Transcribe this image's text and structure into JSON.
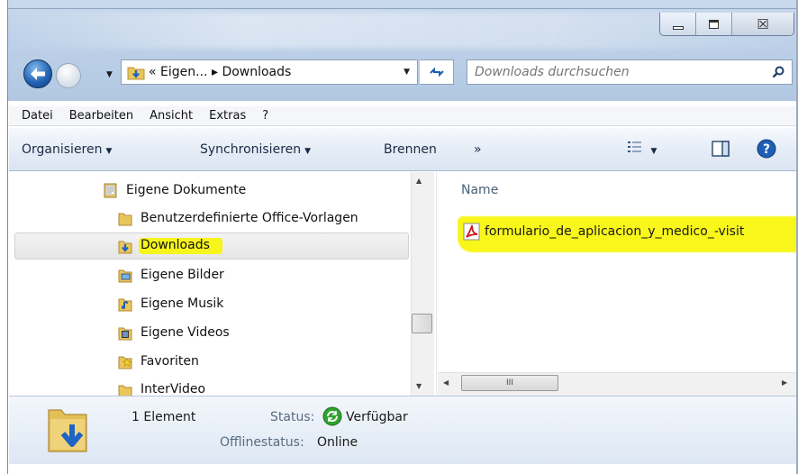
{
  "window": {
    "caption": {
      "minimize": "minimize",
      "maximize": "maximize",
      "close_glyph": "☒"
    }
  },
  "nav": {
    "address_prefix": "«",
    "address_parent": "Eigen...",
    "address_sep": "▸",
    "address_current": "Downloads",
    "search_placeholder": "Downloads durchsuchen"
  },
  "menubar": [
    "Datei",
    "Bearbeiten",
    "Ansicht",
    "Extras",
    "?"
  ],
  "commandbar": {
    "organize": "Organisieren",
    "sync": "Synchronisieren",
    "burn": "Brennen",
    "more": "»"
  },
  "tree": [
    {
      "label": "Eigene Dokumente",
      "icon": "document-folder-icon"
    },
    {
      "label": "Benutzerdefinierte Office-Vorlagen",
      "icon": "folder-icon"
    },
    {
      "label": "Downloads",
      "icon": "downloads-folder-icon",
      "selected": true,
      "highlighted": true
    },
    {
      "label": "Eigene Bilder",
      "icon": "pictures-folder-icon"
    },
    {
      "label": "Eigene Musik",
      "icon": "music-folder-icon"
    },
    {
      "label": "Eigene Videos",
      "icon": "videos-folder-icon"
    },
    {
      "label": "Favoriten",
      "icon": "favorites-folder-icon"
    },
    {
      "label": "InterVideo",
      "icon": "folder-icon"
    }
  ],
  "content": {
    "column_header": "Name",
    "files": [
      {
        "name": "formulario_de_aplicacion_y_medico_-visit",
        "icon": "pdf-icon",
        "highlighted": true
      }
    ],
    "hscroll_grip": "III"
  },
  "details": {
    "count": "1 Element",
    "status_label": "Status:",
    "status_value": "Verfügbar",
    "offline_label": "Offlinestatus:",
    "offline_value": "Online"
  },
  "colors": {
    "highlight": "#f7f51b",
    "accent_blue": "#1f5fb0",
    "status_green": "#2fa32f",
    "pdf_red": "#c8161d",
    "folder_yellow": "#e9c65a"
  }
}
